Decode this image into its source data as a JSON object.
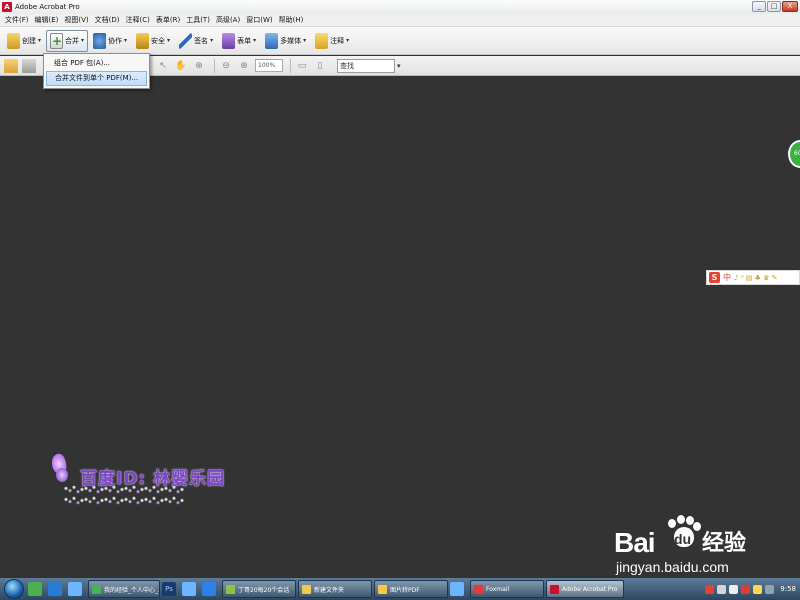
{
  "window": {
    "title": "Adobe Acrobat Pro",
    "app_icon_glyph": "A",
    "controls": {
      "minimize": "_",
      "maximize": "□",
      "close": "X"
    }
  },
  "menubar": {
    "items": [
      "文件(F)",
      "编辑(E)",
      "视图(V)",
      "文档(D)",
      "注释(C)",
      "表单(R)",
      "工具(T)",
      "高级(A)",
      "窗口(W)",
      "帮助(H)"
    ]
  },
  "toolbar": {
    "buttons": [
      {
        "label": "创建",
        "icon": "create-icon"
      },
      {
        "label": "合并",
        "icon": "combine-icon"
      },
      {
        "label": "协作",
        "icon": "collaborate-icon"
      },
      {
        "label": "安全",
        "icon": "lock-icon"
      },
      {
        "label": "签名",
        "icon": "pen-icon"
      },
      {
        "label": "表单",
        "icon": "forms-icon"
      },
      {
        "label": "多媒体",
        "icon": "multimedia-icon"
      },
      {
        "label": "注释",
        "icon": "comment-icon"
      }
    ],
    "caret": "▾"
  },
  "toolbar2": {
    "zoom_value": "100%",
    "find_placeholder": "查找",
    "arrow_glyph": "▾"
  },
  "dropdown": {
    "items": [
      "组合 PDF 包(A)...",
      "合并文件到单个 PDF(M)..."
    ],
    "highlighted_index": 1
  },
  "overlay": {
    "green_bubble_text": "60",
    "ime": {
      "logo": "S",
      "mode": "中",
      "extra": "♪ ⁰ ▤ ♣ ♛ ✎"
    }
  },
  "watermark": {
    "text": "百度ID: 林婴乐园"
  },
  "baidu": {
    "bai": "Bai",
    "du": "du",
    "jingyan": "经验",
    "url": "jingyan.baidu.com"
  },
  "taskbar": {
    "tasks": [
      {
        "label": "我的经验_个人中心_...",
        "color": "#4caf50"
      },
      {
        "label": "丁哥20每20个会话",
        "color": "#8bc34a"
      },
      {
        "label": "新建文件夹",
        "color": "#f2c94c"
      },
      {
        "label": "图片转PDF",
        "color": "#f2c94c"
      },
      {
        "label": "Foxmail",
        "color": "#e53935"
      },
      {
        "label": "Adobe Acrobat Pro",
        "color": "#c8102e"
      }
    ],
    "active_task_index": 5,
    "clock": "9:58"
  }
}
